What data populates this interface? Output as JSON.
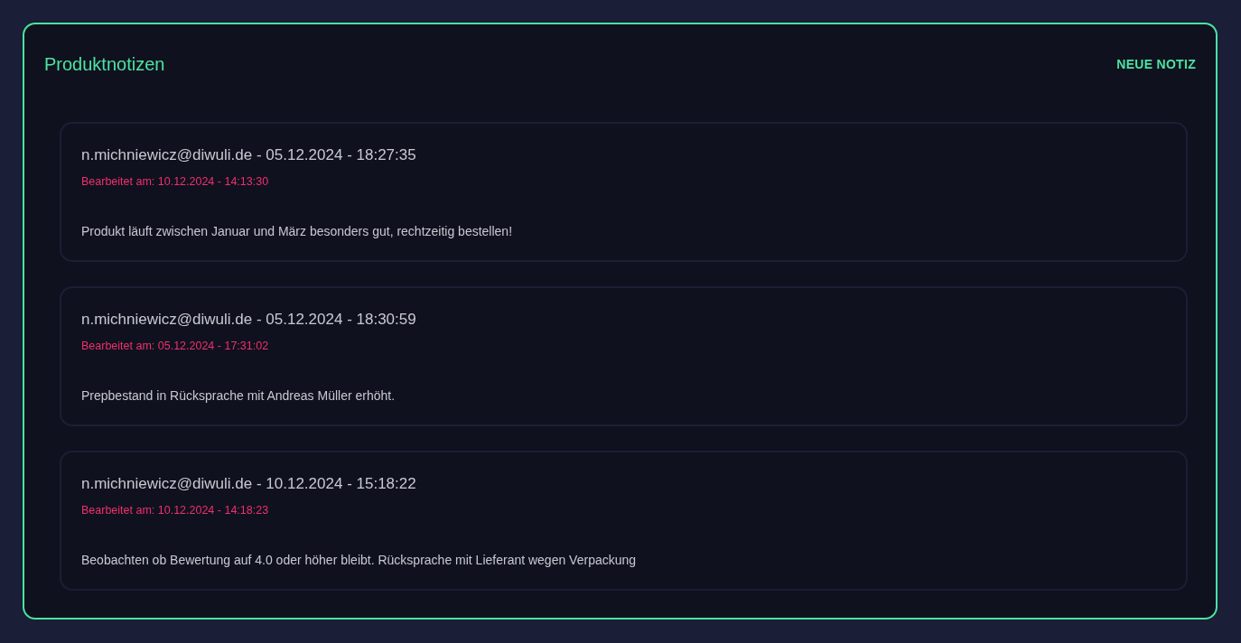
{
  "panel": {
    "title": "Produktnotizen",
    "action": "NEUE NOTIZ"
  },
  "notes": [
    {
      "header": "n.michniewicz@diwuli.de - 05.12.2024 - 18:27:35",
      "edited": "Bearbeitet am: 10.12.2024 - 14:13:30",
      "text": "Produkt läuft zwischen Januar und März besonders gut, rechtzeitig bestellen!"
    },
    {
      "header": "n.michniewicz@diwuli.de - 05.12.2024 - 18:30:59",
      "edited": "Bearbeitet am: 05.12.2024 - 17:31:02",
      "text": "Prepbestand in Rücksprache mit Andreas Müller erhöht."
    },
    {
      "header": "n.michniewicz@diwuli.de - 10.12.2024 - 15:18:22",
      "edited": "Bearbeitet am: 10.12.2024 - 14:18:23",
      "text": "Beobachten ob Bewertung auf 4.0 oder höher bleibt. Rücksprache mit Lieferant wegen Verpackung"
    }
  ]
}
